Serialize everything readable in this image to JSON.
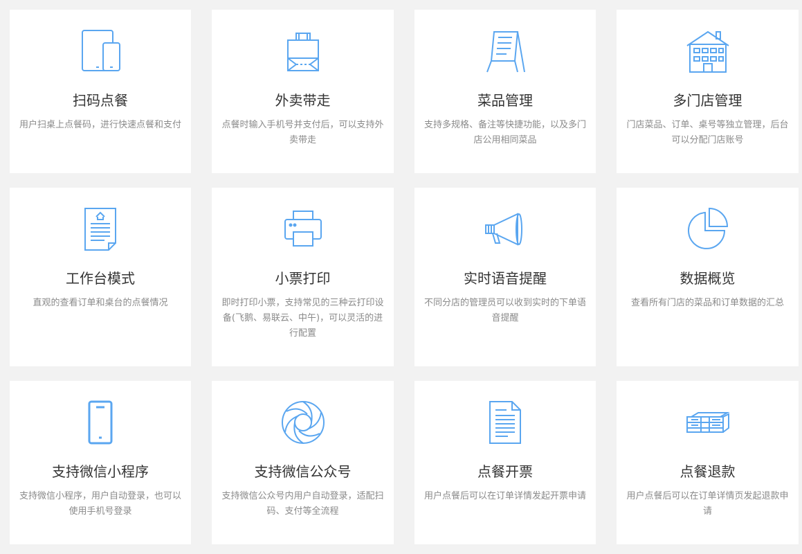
{
  "features": [
    {
      "title": "扫码点餐",
      "desc": "用户扫桌上点餐码，进行快速点餐和支付",
      "icon": "devices-icon"
    },
    {
      "title": "外卖带走",
      "desc": "点餐时输入手机号并支付后，可以支持外卖带走",
      "icon": "takeaway-bag-icon"
    },
    {
      "title": "菜品管理",
      "desc": "支持多规格、备注等快捷功能，以及多门店公用相同菜品",
      "icon": "menu-board-icon"
    },
    {
      "title": "多门店管理",
      "desc": "门店菜品、订单、桌号等独立管理，后台可以分配门店账号",
      "icon": "store-building-icon"
    },
    {
      "title": "工作台模式",
      "desc": "直观的查看订单和桌台的点餐情况",
      "icon": "document-icon"
    },
    {
      "title": "小票打印",
      "desc": "即时打印小票，支持常见的三种云打印设备(飞鹅、易联云、中午)，可以灵活的进行配置",
      "icon": "printer-icon"
    },
    {
      "title": "实时语音提醒",
      "desc": "不同分店的管理员可以收到实时的下单语音提醒",
      "icon": "megaphone-icon"
    },
    {
      "title": "数据概览",
      "desc": "查看所有门店的菜品和订单数据的汇总",
      "icon": "pie-chart-icon"
    },
    {
      "title": "支持微信小程序",
      "desc": "支持微信小程序，用户自动登录，也可以使用手机号登录",
      "icon": "phone-icon"
    },
    {
      "title": "支持微信公众号",
      "desc": "支持微信公众号内用户自动登录，适配扫码、支付等全流程",
      "icon": "aperture-icon"
    },
    {
      "title": "点餐开票",
      "desc": "用户点餐后可以在订单详情发起开票申请",
      "icon": "invoice-icon"
    },
    {
      "title": "点餐退款",
      "desc": "用户点餐后可以在订单详情页发起退款申请",
      "icon": "money-stack-icon"
    }
  ],
  "colors": {
    "accent": "#5aa6f0",
    "title": "#333333",
    "desc": "#8a8a8a",
    "background": "#f2f2f2"
  }
}
